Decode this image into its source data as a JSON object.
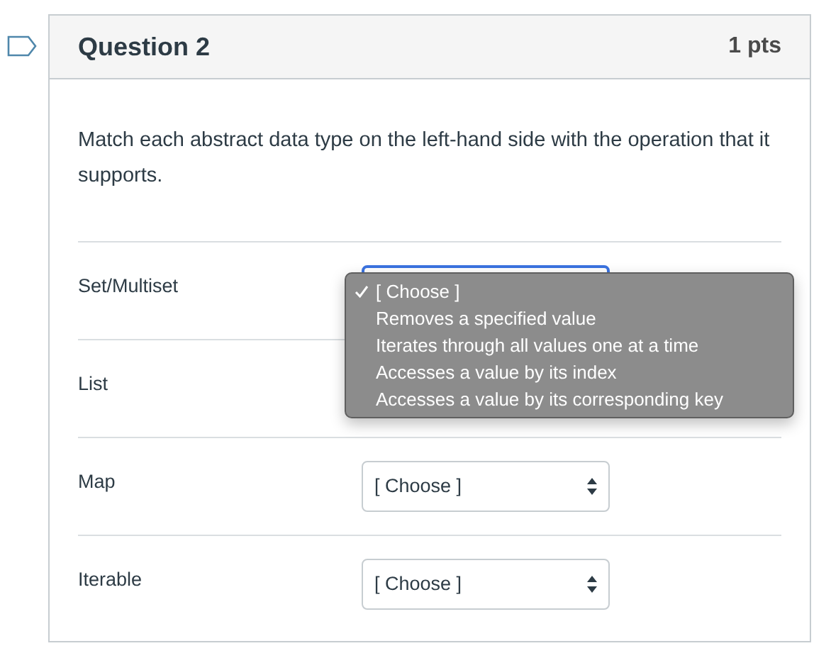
{
  "question": {
    "title": "Question 2",
    "points": "1 pts"
  },
  "prompt": "Match each abstract data type on the left-hand side with the operation that it supports.",
  "rows": [
    {
      "term": "Set/Multiset",
      "select": {
        "focused": true
      },
      "dropdown": {
        "options": [
          {
            "label": "[ Choose ]",
            "checked": true
          },
          {
            "label": "Removes a specified value",
            "checked": false
          },
          {
            "label": "Iterates through all values one at a time",
            "checked": false
          },
          {
            "label": "Accesses a value by its index",
            "checked": false
          },
          {
            "label": "Accesses a value by its corresponding key",
            "checked": false
          }
        ]
      }
    },
    {
      "term": "List"
    },
    {
      "term": "Map",
      "select": {
        "value": "[ Choose ]",
        "focused": false
      }
    },
    {
      "term": "Iterable",
      "select": {
        "value": "[ Choose ]",
        "focused": false
      }
    }
  ]
}
